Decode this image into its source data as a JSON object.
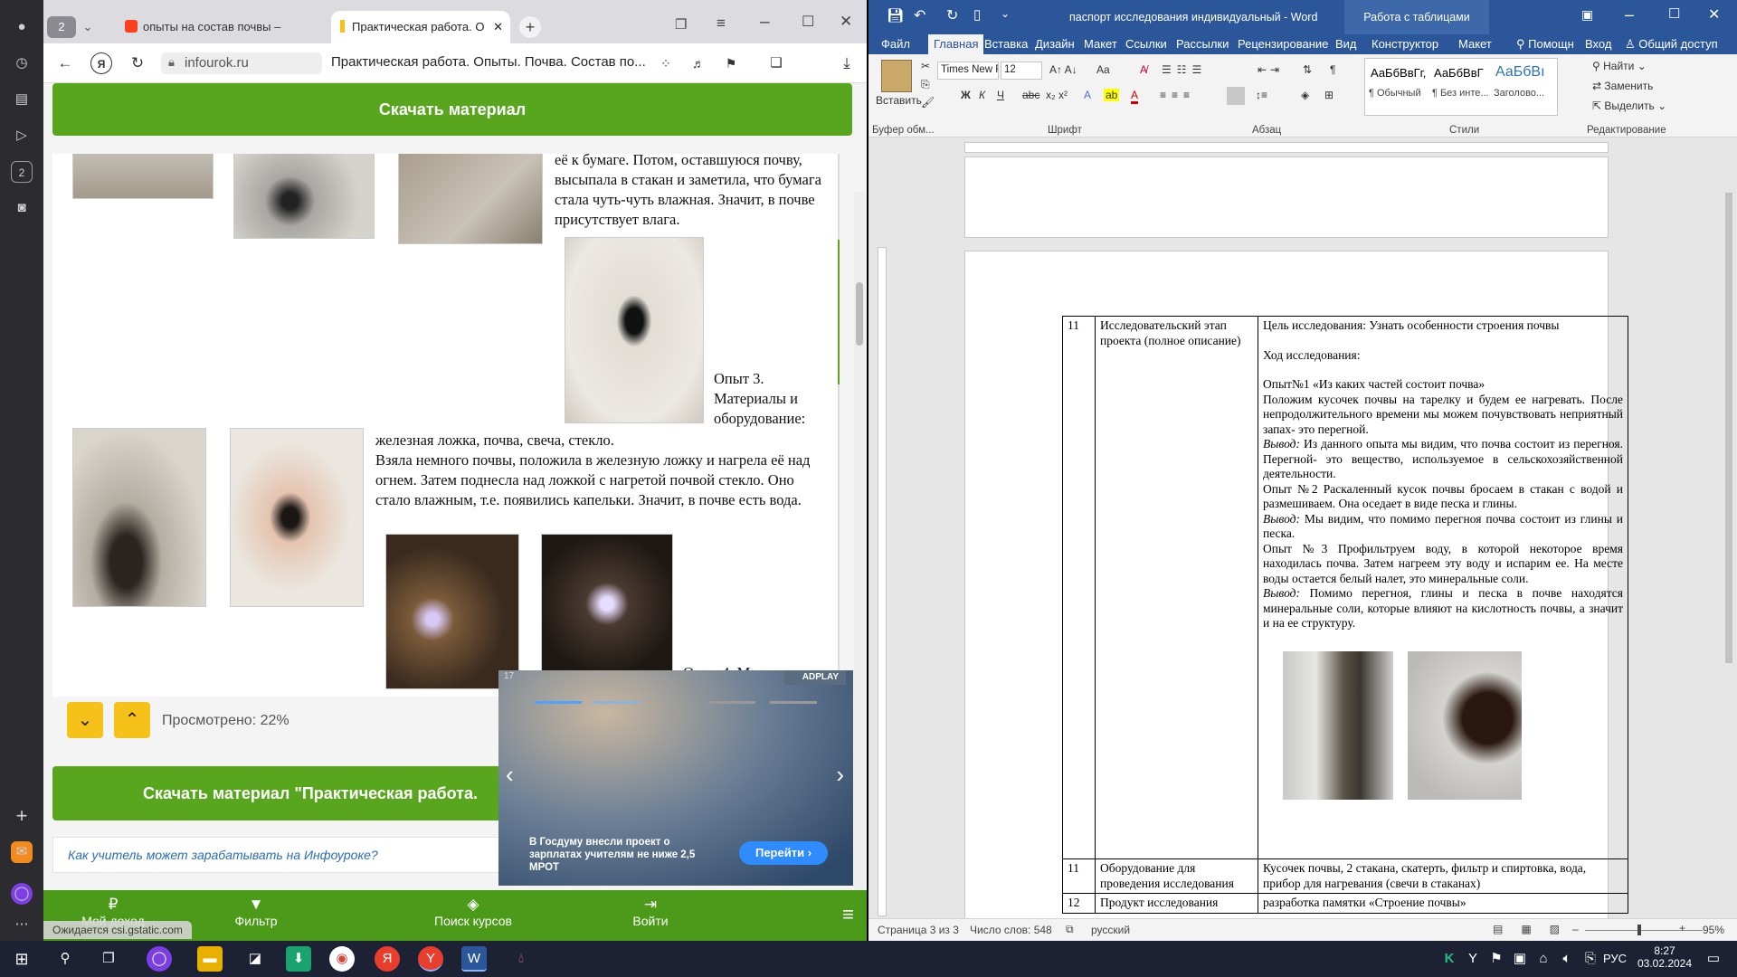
{
  "browser": {
    "tab_count": "2",
    "tabs": [
      {
        "label": "опыты на состав почвы –",
        "active": false
      },
      {
        "label": "Практическая работа. О",
        "active": true
      }
    ],
    "domain": "infourok.ru",
    "page_title": "Практическая работа. Опыты. Почва. Состав по...",
    "download_top": "Скачать материал",
    "article": {
      "p1": "её к бумаге. Потом, оставшуюся почву, высыпала в стакан и заметила, что бумага стала чуть-чуть влажная. Значит, в почве присутствует влага.",
      "exp3_title": "Опыт 3.",
      "exp3_materials": "Материалы и оборудование:",
      "exp3_list": "железная ложка, почва, свеча, стекло.",
      "exp3_text": "Взяла немного почвы, положила в железную ложку и нагрела её над огнем. Затем поднесла над ложкой с нагретой почвой стекло. Оно стало влажным, т.е. появились капельки. Значит, в почве есть вода.",
      "exp4": "Опыт 4. Мат"
    },
    "viewed": "Просмотрено: 22%",
    "download_bottom": "Скачать материал \"Практическая работа.",
    "teacher_link": "Как учитель может зарабатывать на Инфоуроке?",
    "ad": {
      "badge": "ADPLAY",
      "counter": "17",
      "text": "В Госдуму внесли проект о зарплатах учителям не ниже 2,5 МРОТ",
      "button": "Перейти"
    },
    "nav": [
      {
        "label": "Мой доход",
        "icon": "ruble-icon"
      },
      {
        "label": "Фильтр",
        "icon": "filter-icon"
      },
      {
        "label": "Поиск курсов",
        "icon": "courses-icon"
      },
      {
        "label": "Войти",
        "icon": "login-icon"
      }
    ],
    "status_url": "Ожидается csi.gstatic.com"
  },
  "word": {
    "title": "паспорт исследования индивидуальный - Word",
    "context_tab": "Работа с таблицами",
    "tabs": [
      "Файл",
      "Главная",
      "Вставка",
      "Дизайн",
      "Макет",
      "Ссылки",
      "Рассылки",
      "Рецензирование",
      "Вид",
      "Конструктор",
      "Макет"
    ],
    "tell_me": "Помощн",
    "signin": "Вход",
    "share": "Общий доступ",
    "ribbon": {
      "paste": "Вставить",
      "font_name": "Times New R",
      "font_size": "12",
      "groups": [
        "Буфер обм...",
        "Шрифт",
        "Абзац",
        "Стили",
        "Редактирование"
      ],
      "styles": [
        {
          "preview": "АаБбВвГг,",
          "name": "¶ Обычный"
        },
        {
          "preview": "АаБбВвГ",
          "name": "¶ Без инте..."
        },
        {
          "preview": "АаБбВı",
          "name": "Заголово..."
        }
      ],
      "find": "Найти",
      "replace": "Заменить",
      "select": "Выделить"
    },
    "table": {
      "rows": [
        {
          "num": "11",
          "label": "Исследовательский этап проекта (полное описание)",
          "goal": "Цель исследования: Узнать особенности строения почвы",
          "course": "Ход исследования:",
          "exp1_title": "Опыт№1 «Из каких частей состоит почва»",
          "exp1_text": "Положим кусочек почвы на тарелку и будем ее нагревать. После непродолжительного времени мы можем почувствовать неприятный запах- это перегной.",
          "out1_label": "Вывод:",
          "out1_text": "Из данного опыта мы видим, что почва состоит из перегноя. Перегной- это вещество, используемое в сельскохозяйственной деятельности.",
          "exp2_text": "Опыт №2 Раскаленный кусок почвы бросаем в стакан с водой и размешиваем. Она оседает в виде песка и глины.",
          "out2_label": "Вывод:",
          "out2_text": "Мы видим, что помимо перегноя почва состоит из глины и песка.",
          "exp3_text": "Опыт №3 Профильтруем воду, в которой некоторое время находилась почва. Затем нагреем эту воду и испарим ее. На месте воды остается белый налет, это минеральные соли.",
          "out3_label": "Вывод:",
          "out3_text": "Помимо перегноя, глины и песка в почве находятся минеральные соли, которые влияют на кислотность почвы, а значит и на ее структуру."
        },
        {
          "num": "11",
          "label": "Оборудование для проведения исследования",
          "content": "Кусочек почвы, 2 стакана, скатерть, фильтр и спиртовка, вода, прибор для нагревания (свечи в стаканах)"
        },
        {
          "num": "12",
          "label": "Продукт исследования",
          "content": "разработка памятки «Строение почвы»"
        }
      ]
    },
    "status": {
      "page": "Страница 3 из 3",
      "words": "Число слов: 548",
      "lang": "русский",
      "zoom": "95%"
    }
  },
  "taskbar": {
    "lang": "РУС",
    "time": "8:27",
    "date": "03.02.2024"
  }
}
